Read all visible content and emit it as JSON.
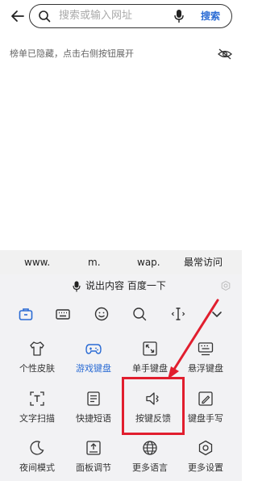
{
  "search": {
    "placeholder": "搜索或输入网址",
    "button": "搜索"
  },
  "notice": {
    "text": "榜单已隐藏，点击右侧按钮展开"
  },
  "quick_bar": {
    "items": [
      "www.",
      "m.",
      "wap.",
      "最常访问"
    ]
  },
  "voice": {
    "label": "说出内容 百度一下"
  },
  "toolbar": {
    "icons": [
      "briefcase-icon",
      "keyboard-icon",
      "emoji-icon",
      "search-icon",
      "cursor-icon",
      "chevron-down-icon"
    ]
  },
  "grid": {
    "items": [
      {
        "label": "个性皮肤",
        "icon": "shirt-icon"
      },
      {
        "label": "游戏键盘",
        "icon": "gamepad-icon",
        "active": true
      },
      {
        "label": "单手键盘",
        "icon": "one-hand-icon"
      },
      {
        "label": "悬浮键盘",
        "icon": "floating-keyboard-icon"
      },
      {
        "label": "文字扫描",
        "icon": "scan-text-icon"
      },
      {
        "label": "快捷短语",
        "icon": "phrase-icon"
      },
      {
        "label": "按键反馈",
        "icon": "speaker-vibrate-icon",
        "highlighted": true
      },
      {
        "label": "键盘手写",
        "icon": "handwriting-icon"
      },
      {
        "label": "夜间模式",
        "icon": "moon-icon"
      },
      {
        "label": "面板调节",
        "icon": "panel-adjust-icon"
      },
      {
        "label": "更多语言",
        "icon": "globe-icon"
      },
      {
        "label": "更多设置",
        "icon": "settings-hex-icon"
      }
    ]
  },
  "colors": {
    "accent": "#2a6bd4",
    "highlight": "#e11e2e",
    "keyboard_bg": "#f2f2f4",
    "quick_bar_bg": "#f1f1f1"
  }
}
